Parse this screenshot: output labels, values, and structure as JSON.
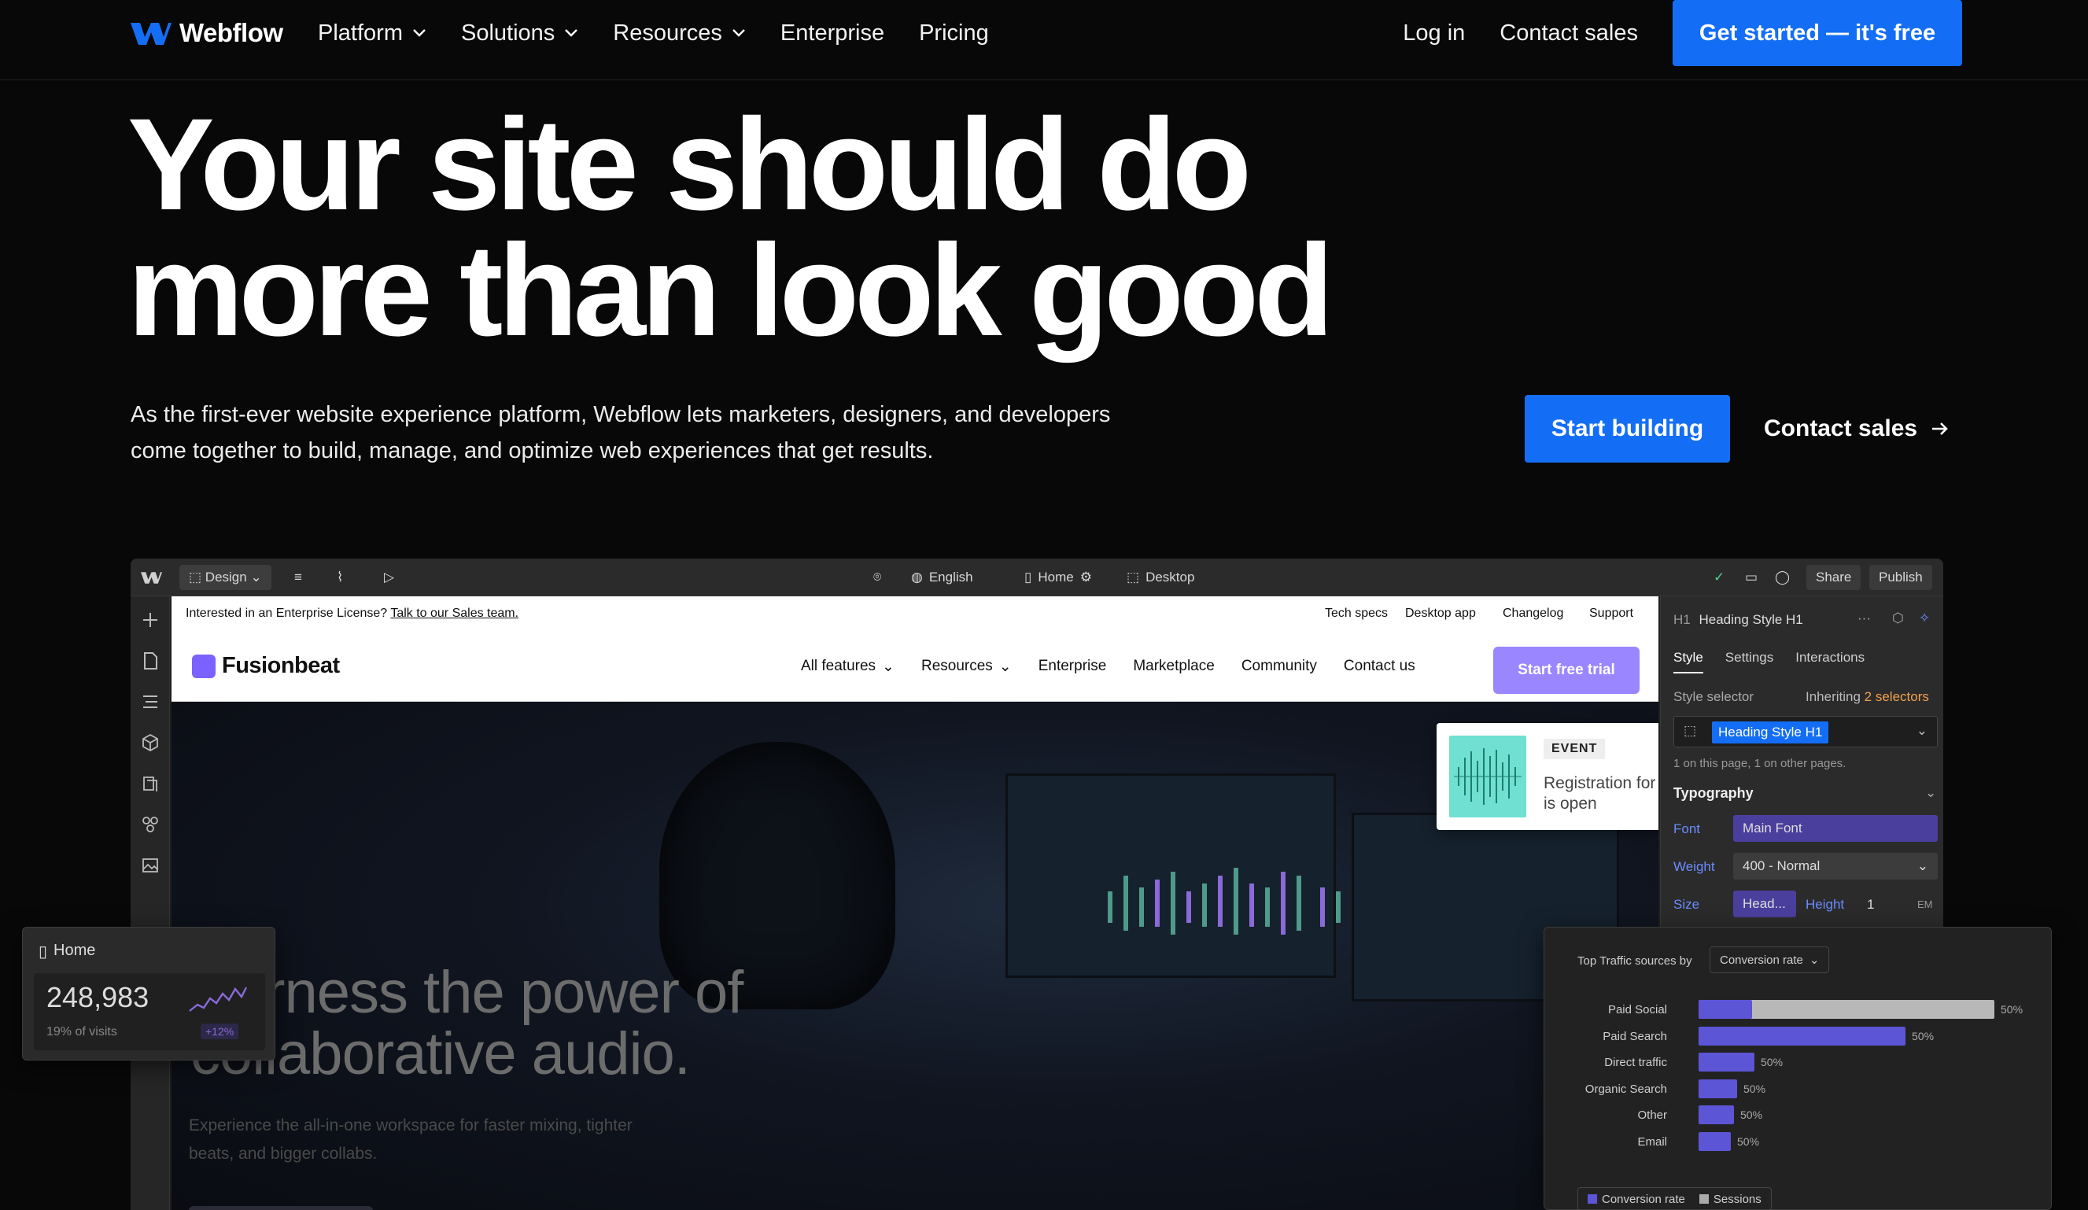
{
  "nav": {
    "logo_text": "Webflow",
    "links": [
      {
        "label": "Platform",
        "has_dropdown": true
      },
      {
        "label": "Solutions",
        "has_dropdown": true
      },
      {
        "label": "Resources",
        "has_dropdown": true
      },
      {
        "label": "Enterprise",
        "has_dropdown": false
      },
      {
        "label": "Pricing",
        "has_dropdown": false
      }
    ],
    "login": "Log in",
    "contact_sales": "Contact sales",
    "cta": "Get started — it's free"
  },
  "hero": {
    "title_line1": "Your site should do",
    "title_line2": "more than look good",
    "subtitle_line1": "As the first-ever website experience platform, Webflow lets marketers, designers, and developers",
    "subtitle_line2": "come together to build, manage, and optimize web experiences that get results.",
    "start_building": "Start building",
    "contact_sales": "Contact sales",
    "accent_color": "#146ef5"
  },
  "designer": {
    "topbar": {
      "mode": "Design",
      "language": "English",
      "page": "Home",
      "breakpoint": "Desktop",
      "share": "Share",
      "publish": "Publish"
    },
    "site": {
      "strip_text": "Interested in an Enterprise License?",
      "strip_link": "Talk to our Sales team.",
      "strip_links": [
        "Tech specs",
        "Desktop app",
        "Changelog",
        "Support"
      ],
      "logo": "Fusionbeat",
      "nav": [
        {
          "label": "All features",
          "has_dropdown": true
        },
        {
          "label": "Resources",
          "has_dropdown": true
        },
        {
          "label": "Enterprise",
          "has_dropdown": false
        },
        {
          "label": "Marketplace",
          "has_dropdown": false
        },
        {
          "label": "Community",
          "has_dropdown": false
        },
        {
          "label": "Contact us",
          "has_dropdown": false
        }
      ],
      "trial_button": "Start free trial",
      "event_tag": "EVENT",
      "event_text": "Registration for FusionConf is open",
      "headline_line1": "Harness the power of",
      "headline_line2": "collaborative audio.",
      "paragraph_line1": "Experience the all-in-one workspace for faster mixing, tighter",
      "paragraph_line2": "beats, and bigger collabs."
    },
    "panel": {
      "element": "H1",
      "element_name": "Heading Style H1",
      "tabs": [
        "Style",
        "Settings",
        "Interactions"
      ],
      "style_selector": "Style selector",
      "inheriting": "Inheriting",
      "selectors": "2 selectors",
      "chip": "Heading Style H1",
      "usage": "1 on this page, 1 on other pages.",
      "typography": "Typography",
      "font_label": "Font",
      "font_value": "Main Font",
      "weight_label": "Weight",
      "weight_value": "400 - Normal",
      "size_label": "Size",
      "size_value": "Head...",
      "height_label": "Height",
      "height_value": "1",
      "height_unit": "EM"
    }
  },
  "home_card": {
    "title": "Home",
    "value": "248,983",
    "sub": "19% of visits",
    "delta": "+12%"
  },
  "traffic": {
    "title": "Top Traffic sources by",
    "dropdown": "Conversion rate",
    "rows": [
      {
        "label": "Paid Social",
        "value": "50%",
        "fraction": 1.0,
        "sessions_fraction": 0.82
      },
      {
        "label": "Paid Search",
        "value": "50%",
        "fraction": 0.7,
        "sessions_fraction": 0
      },
      {
        "label": "Direct traffic",
        "value": "50%",
        "fraction": 0.19,
        "sessions_fraction": 0
      },
      {
        "label": "Organic Search",
        "value": "50%",
        "fraction": 0.13,
        "sessions_fraction": 0
      },
      {
        "label": "Other",
        "value": "50%",
        "fraction": 0.12,
        "sessions_fraction": 0
      },
      {
        "label": "Email",
        "value": "50%",
        "fraction": 0.11,
        "sessions_fraction": 0
      }
    ],
    "legend": [
      "Conversion rate",
      "Sessions"
    ]
  }
}
